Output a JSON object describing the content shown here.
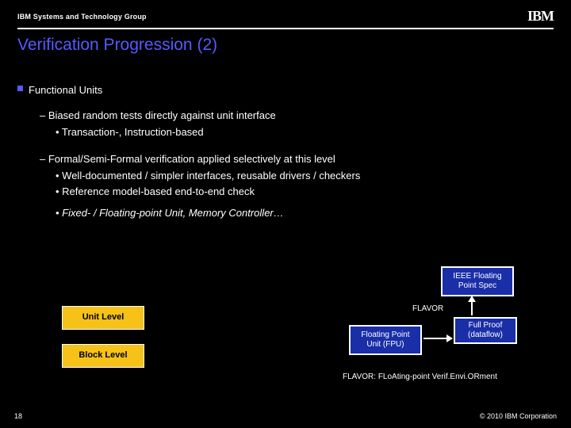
{
  "header": {
    "group": "IBM Systems and Technology Group",
    "logo": "IBM"
  },
  "title": "Verification Progression (2)",
  "bullets": {
    "main": "Functional Units",
    "s1a": "– Biased random tests directly against unit interface",
    "s1a1": "• Transaction-, Instruction-based",
    "s1b": "– Formal/Semi-Formal verification applied selectively at this level",
    "s1b1": "• Well-documented / simpler interfaces, reusable drivers / checkers",
    "s1b2": "• Reference model-based end-to-end check",
    "s1c": "• Fixed- / Floating-point Unit, Memory Controller…"
  },
  "diagram": {
    "unit_level": "Unit Level",
    "block_level": "Block Level",
    "ieee_spec": "IEEE Floating Point Spec",
    "fpu": "Floating Point Unit (FPU)",
    "full_proof": "Full Proof (dataflow)",
    "flavor_label": "FLAVOR",
    "footnote": "FLAVOR: FLoAting-point Verif.Envi.ORment"
  },
  "footer": {
    "page": "18",
    "copyright": "© 2010 IBM Corporation"
  }
}
